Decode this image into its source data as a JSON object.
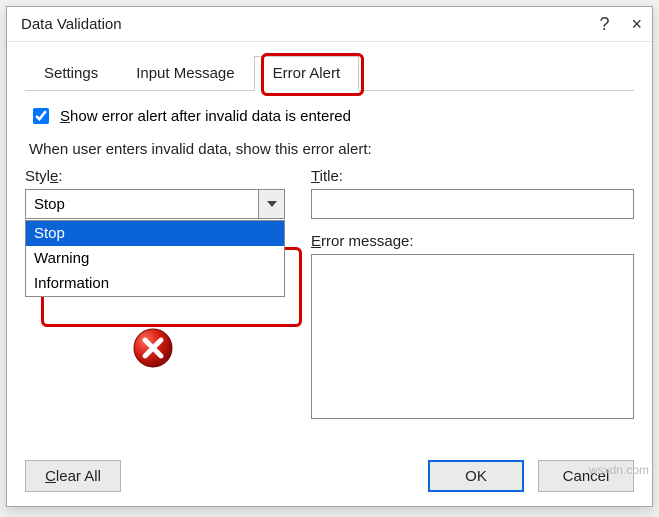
{
  "titlebar": {
    "title": "Data Validation",
    "help": "?",
    "close": "×"
  },
  "tabs": {
    "settings": "Settings",
    "input_message": "Input Message",
    "error_alert": "Error Alert"
  },
  "chk": {
    "label_pre": "S",
    "label_rest": "how error alert after invalid data is entered"
  },
  "subhead": "When user enters invalid data, show this error alert:",
  "style": {
    "label_pre": "Styl",
    "label_under": "e",
    "label_post": ":",
    "value": "Stop",
    "options": [
      "Stop",
      "Warning",
      "Information"
    ]
  },
  "title_f": {
    "label_under": "T",
    "label_rest": "itle:"
  },
  "msg_f": {
    "label_pre": "E",
    "label_rest": "rror message:"
  },
  "buttons": {
    "clear_under": "C",
    "clear_rest": "lear All",
    "ok": "OK",
    "cancel": "Cancel"
  },
  "watermark": "wsxdn.com"
}
